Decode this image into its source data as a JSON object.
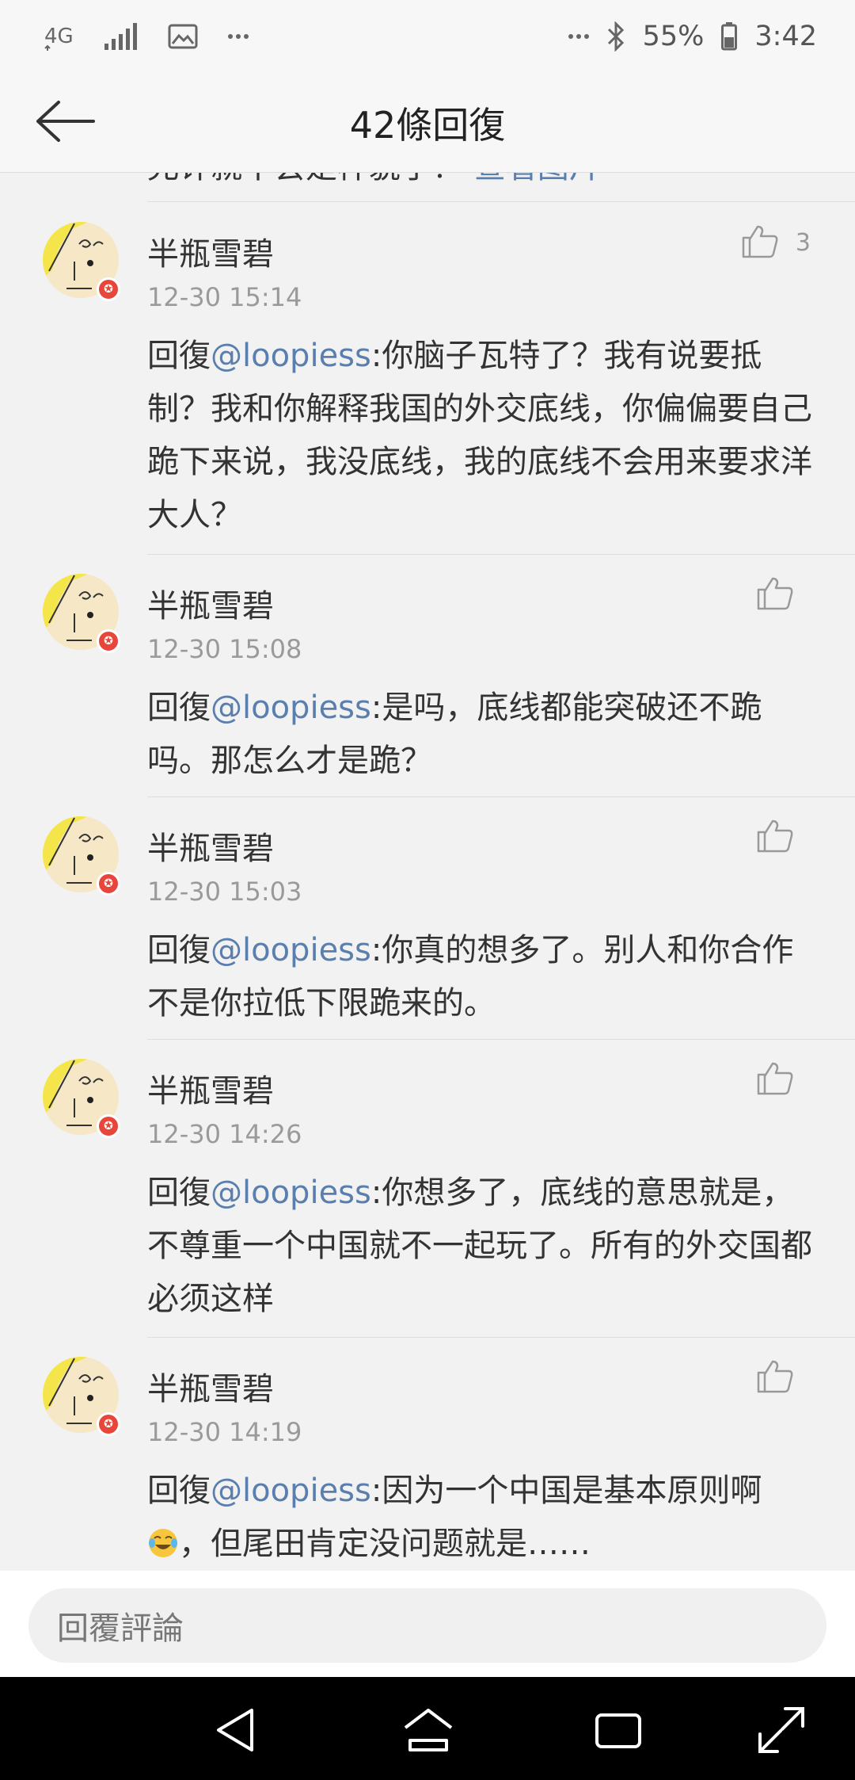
{
  "status_bar": {
    "network": "4G",
    "battery": "55%",
    "time": "3:42"
  },
  "header": {
    "title": "42條回復"
  },
  "cut_row": {
    "prefix": "允许就不会是样貌了？",
    "link": "查看图片"
  },
  "comments": [
    {
      "name": "半瓶雪碧",
      "time": "12-30 15:14",
      "likes": "3",
      "prefix": "回復",
      "mention": "@loopiess",
      "body": ":你脑子瓦特了？我有说要抵制？我和你解释我国的外交底线，你偏偏要自己跪下来说，我没底线，我的底线不会用来要求洋大人？"
    },
    {
      "name": "半瓶雪碧",
      "time": "12-30 15:08",
      "likes": "",
      "prefix": "回復",
      "mention": "@loopiess",
      "body": ":是吗，底线都能突破还不跪吗。那怎么才是跪？"
    },
    {
      "name": "半瓶雪碧",
      "time": "12-30 15:03",
      "likes": "",
      "prefix": "回復",
      "mention": "@loopiess",
      "body": ":你真的想多了。别人和你合作不是你拉低下限跪来的。"
    },
    {
      "name": "半瓶雪碧",
      "time": "12-30 14:26",
      "likes": "",
      "prefix": "回復",
      "mention": "@loopiess",
      "body": ":你想多了，底线的意思就是，不尊重一个中国就不一起玩了。所有的外交国都必须这样"
    },
    {
      "name": "半瓶雪碧",
      "time": "12-30 14:19",
      "likes": "",
      "prefix": "回復",
      "mention": "@loopiess",
      "body": ":因为一个中国是基本原则啊",
      "body2": "，但尾田肯定没问题就是……"
    }
  ],
  "reply_bar": {
    "placeholder": "回覆評論"
  },
  "colors": {
    "link": "#5a7fae",
    "verify_badge": "#e8463a"
  }
}
